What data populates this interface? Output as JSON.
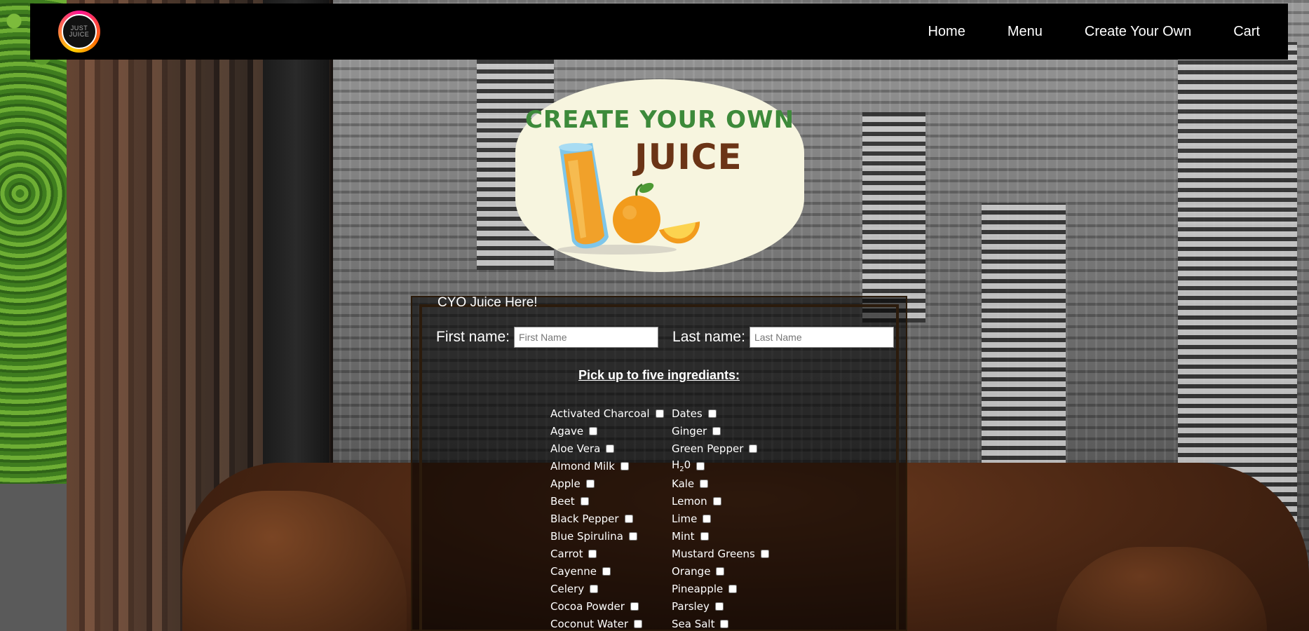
{
  "nav": {
    "logo_text_top": "JUST",
    "logo_text_bottom": "JUICE",
    "links": [
      "Home",
      "Menu",
      "Create Your Own",
      "Cart"
    ]
  },
  "hero": {
    "line1": "CREATE YOUR OWN",
    "line2": "JUICE"
  },
  "form": {
    "legend": "CYO Juice Here!",
    "first_name_label": "First name:",
    "first_name_placeholder": "First Name",
    "last_name_label": "Last name:",
    "last_name_placeholder": "Last Name",
    "ingredients_heading": "Pick up to five ingrediants:",
    "column1": [
      "Activated Charcoal",
      "Agave",
      "Aloe Vera",
      "Almond Milk",
      "Apple",
      "Beet",
      "Black Pepper",
      "Blue Spirulina",
      "Carrot",
      "Cayenne",
      "Celery",
      "Cocoa Powder",
      "Coconut Water"
    ],
    "column2": [
      "Dates",
      "Ginger",
      "Green Pepper",
      "H20",
      "Kale",
      "Lemon",
      "Lime",
      "Mint",
      "Mustard Greens",
      "Orange",
      "Pineapple",
      "Parsley",
      "Sea Salt"
    ]
  },
  "colors": {
    "navbar": "#000000",
    "hero_bg": "#f7f5df",
    "hero_green": "#3d8a3a",
    "hero_brown": "#6b3416"
  }
}
